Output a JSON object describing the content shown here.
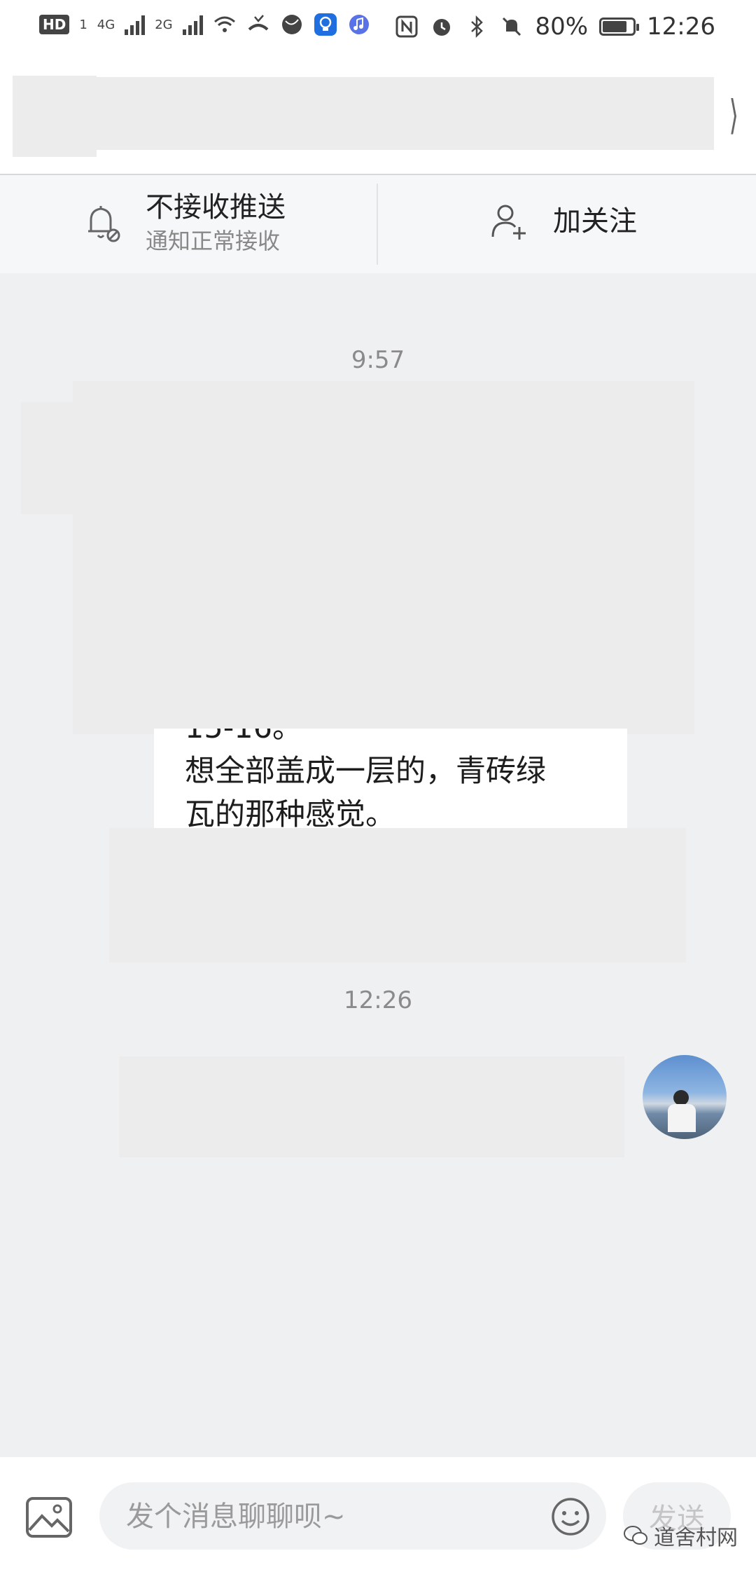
{
  "status_bar": {
    "hd_badge": "HD",
    "sim1": "1",
    "net1": "4G",
    "net2": "2G",
    "battery_percent": "80%",
    "battery_level": 0.8,
    "time": "12:26"
  },
  "action_bar": {
    "push_title": "不接收推送",
    "push_subtitle": "通知正常接收",
    "follow_label": "加关注"
  },
  "chat": {
    "timestamp_1": "9:57",
    "message_partial_line": "15-16。",
    "message_line_1": "想全部盖成一层的，青砖绿",
    "message_line_2": "瓦的那种感觉。",
    "timestamp_2": "12:26"
  },
  "input_bar": {
    "placeholder": "发个消息聊聊呗~",
    "send_label": "发送"
  },
  "watermark": "道舍村网",
  "colors": {
    "background": "#eff0f2",
    "redaction": "#ececec",
    "bubble": "#ffffff",
    "muted_text": "#8a8a8a"
  }
}
